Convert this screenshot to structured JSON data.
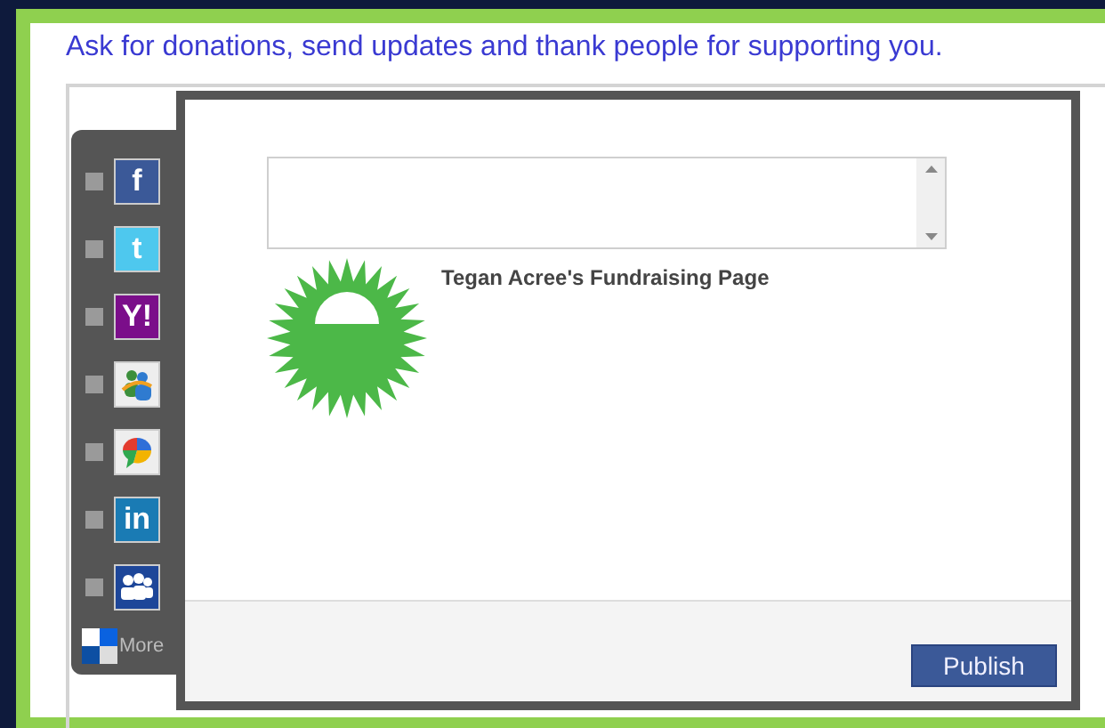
{
  "heading": "Ask for donations, send updates and thank people for supporting you.",
  "share_services": [
    {
      "kind": "facebook",
      "glyph": "f",
      "checked": false
    },
    {
      "kind": "twitter",
      "glyph": "t",
      "checked": false
    },
    {
      "kind": "yahoo",
      "glyph": "Y!",
      "checked": false
    },
    {
      "kind": "messenger",
      "checked": false
    },
    {
      "kind": "buzz",
      "checked": false
    },
    {
      "kind": "linkedin",
      "glyph": "in",
      "checked": false
    },
    {
      "kind": "myspace",
      "checked": false
    }
  ],
  "more_link": "More",
  "page_title": "Tegan Acree's Fundraising Page",
  "publish_button": "Publish"
}
